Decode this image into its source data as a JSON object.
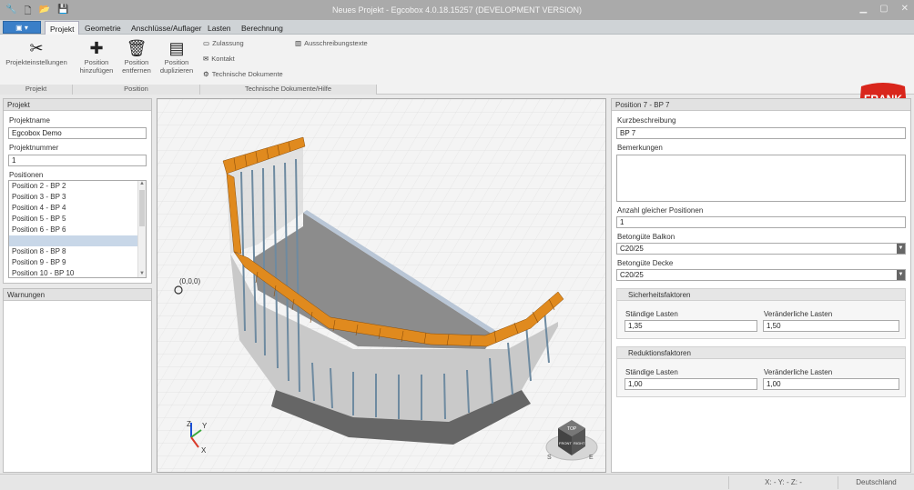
{
  "window": {
    "title": "Neues Projekt - Egcobox 4.0.18.15257 (DEVELOPMENT VERSION)",
    "controls": [
      "minimize",
      "maximize",
      "close"
    ]
  },
  "quick_access": [
    "app-icon",
    "new-icon",
    "open-icon",
    "save-icon"
  ],
  "ribbon": {
    "app_button": "▣ ▾",
    "tabs": [
      "Projekt",
      "Geometrie",
      "Anschlüsse/Auflager",
      "Lasten",
      "Berechnung"
    ],
    "active_tab": "Projekt",
    "groups": {
      "projekt": {
        "label": "Projekt",
        "buttons": [
          {
            "label": "Projekteinstellungen",
            "icon": "tools-icon"
          }
        ]
      },
      "position": {
        "label": "Position",
        "buttons": [
          {
            "label": "Position hinzufügen",
            "icon": "plus-icon"
          },
          {
            "label": "Position entfernen",
            "icon": "trash-icon"
          },
          {
            "label": "Position duplizieren",
            "icon": "duplicate-icon"
          }
        ]
      },
      "docs": {
        "label": "Technische Dokumente/Hilfe",
        "items": [
          {
            "label": "Zulassung",
            "icon": "document-icon"
          },
          {
            "label": "Kontakt",
            "icon": "mail-icon"
          },
          {
            "label": "Technische Dokumente",
            "icon": "settings-icon"
          },
          {
            "label": "Ausschreibungstexte",
            "icon": "text-icon"
          }
        ]
      }
    },
    "logo_text": "FRANK"
  },
  "left": {
    "project_panel_title": "Projekt",
    "projektname_label": "Projektname",
    "projektname_value": "Egcobox Demo",
    "projektnummer_label": "Projektnummer",
    "projektnummer_value": "1",
    "positionen_label": "Positionen",
    "positions": [
      "Position 2 - BP 2",
      "Position 3 - BP 3",
      "Position 4 - BP 4",
      "Position 5 - BP 5",
      "Position 6 - BP 6",
      "Position 7 - BP 7",
      "Position 8 - BP 8",
      "Position 9 - BP 9",
      "Position 10 - BP 10"
    ],
    "selected_position": "Position 7 - BP 7",
    "warnings_title": "Warnungen"
  },
  "viewport": {
    "origin_label": "(0,0,0)",
    "axes": {
      "x": "X",
      "y": "Y",
      "z": "Z"
    },
    "nav_cube": {
      "top": "TOP",
      "front": "FRONT",
      "right": "RIGHT",
      "compass_s": "S",
      "compass_e": "E"
    }
  },
  "right": {
    "title": "Position 7 - BP 7",
    "kurzbeschreibung_label": "Kurzbeschreibung",
    "kurzbeschreibung_value": "BP 7",
    "bemerkungen_label": "Bemerkungen",
    "bemerkungen_value": "",
    "anzahl_label": "Anzahl gleicher Positionen",
    "anzahl_value": "1",
    "beton_balkon_label": "Betongüte Balkon",
    "beton_balkon_value": "C20/25",
    "beton_decke_label": "Betongüte Decke",
    "beton_decke_value": "C20/25",
    "sicherheit": {
      "title": "Sicherheitsfaktoren",
      "staendig_label": "Ständige Lasten",
      "staendig_value": "1,35",
      "veraenderlich_label": "Veränderliche Lasten",
      "veraenderlich_value": "1,50"
    },
    "reduktion": {
      "title": "Reduktionsfaktoren",
      "staendig_label": "Ständige Lasten",
      "staendig_value": "1,00",
      "veraenderlich_label": "Veränderliche Lasten",
      "veraenderlich_value": "1,00"
    }
  },
  "status": {
    "coords": "X: -   Y: -   Z: -",
    "country": "Deutschland"
  },
  "colors": {
    "accent": "#3a7fc8",
    "logo_red": "#d9261c",
    "insulation_orange": "#e08a1e"
  }
}
